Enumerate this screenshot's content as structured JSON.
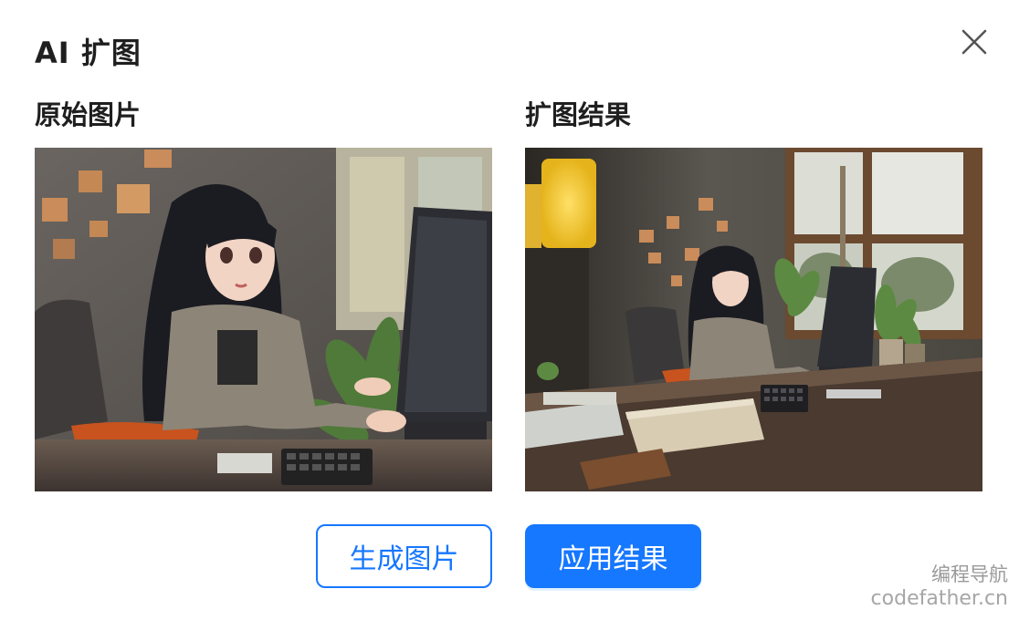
{
  "dialog": {
    "title": "AI 扩图",
    "close_icon": "close-icon"
  },
  "original": {
    "label": "原始图片",
    "image_description": "anime-style girl with long black hair at desk with computer monitor, keyboard, potted plant, orange chair"
  },
  "result": {
    "label": "扩图结果",
    "image_description": "expanded scene: same girl at long wooden desk, yellow pendant lamp, window with trees, plants, papers"
  },
  "buttons": {
    "generate_label": "生成图片",
    "apply_label": "应用结果"
  },
  "watermark": {
    "line1": "编程导航",
    "line2": "codefather.cn"
  },
  "colors": {
    "primary": "#1677ff",
    "text": "#1f1f1f",
    "watermark": "#9a9a9a"
  }
}
